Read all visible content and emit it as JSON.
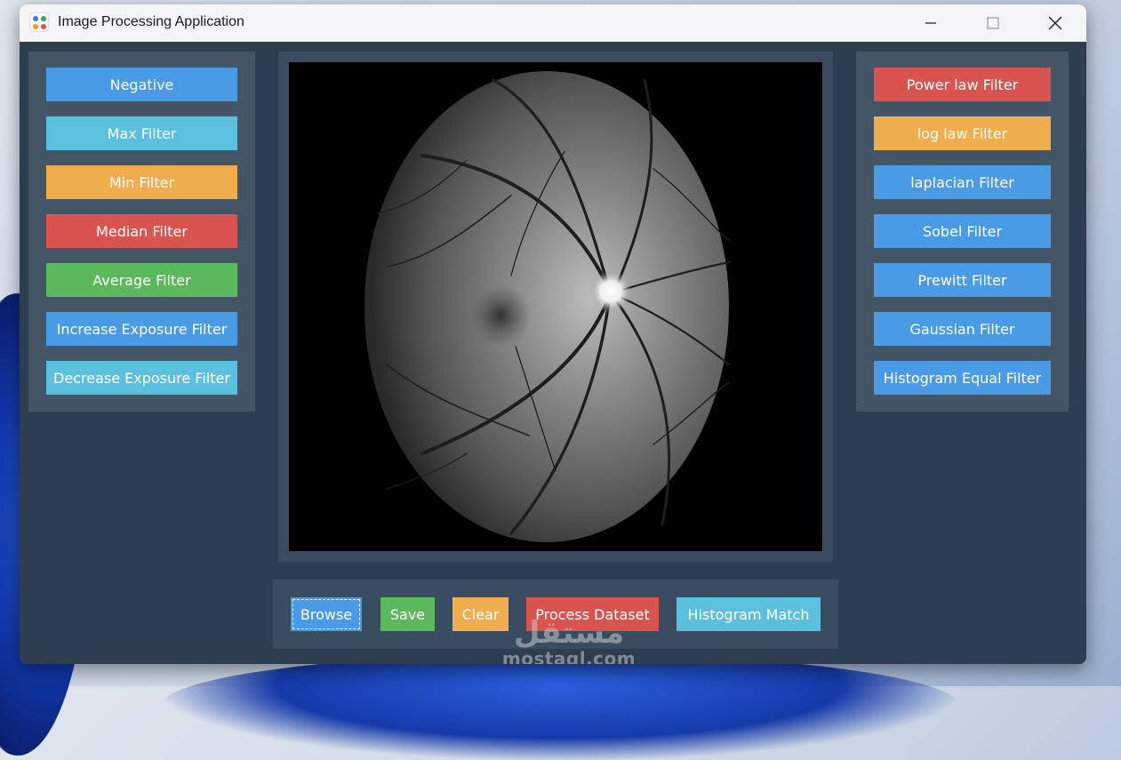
{
  "window": {
    "title": "Image Processing Application",
    "controls": [
      "minimize-icon",
      "maximize-icon",
      "close-icon"
    ]
  },
  "left_panel": {
    "buttons": [
      {
        "label": "Negative",
        "color": "#4a9be6"
      },
      {
        "label": "Max Filter",
        "color": "#5bc0de"
      },
      {
        "label": "Min Filter",
        "color": "#f0ad4e"
      },
      {
        "label": "Median Filter",
        "color": "#d9534f"
      },
      {
        "label": "Average Filter",
        "color": "#5cb85c"
      },
      {
        "label": "Increase Exposure Filter",
        "color": "#4a9be6"
      },
      {
        "label": "Decrease Exposure Filter",
        "color": "#5bc0de"
      }
    ]
  },
  "right_panel": {
    "buttons": [
      {
        "label": "Power law Filter",
        "color": "#d9534f"
      },
      {
        "label": "log law Filter",
        "color": "#f0ad4e"
      },
      {
        "label": "laplacian Filter",
        "color": "#4a9be6"
      },
      {
        "label": "Sobel Filter",
        "color": "#4a9be6"
      },
      {
        "label": "Prewitt Filter",
        "color": "#4a9be6"
      },
      {
        "label": "Gaussian Filter",
        "color": "#4a9be6"
      },
      {
        "label": "Histogram Equal Filter",
        "color": "#4a9be6"
      }
    ]
  },
  "bottom_bar": {
    "buttons": [
      {
        "label": "Browse",
        "color": "#4a9be6"
      },
      {
        "label": "Save",
        "color": "#5cb85c"
      },
      {
        "label": "Clear",
        "color": "#f0ad4e"
      },
      {
        "label": "Process Dataset",
        "color": "#d9534f"
      },
      {
        "label": "Histogram Match",
        "color": "#5bc0de"
      }
    ]
  },
  "image_view": {
    "content": "retina-fundus-grayscale"
  },
  "watermark": {
    "arabic": "مستقل",
    "latin": "mostaql.com"
  },
  "colors": {
    "window_bg": "#2c3e50",
    "panel_bg": "#445566",
    "titlebar_bg": "#f5f5f7"
  }
}
